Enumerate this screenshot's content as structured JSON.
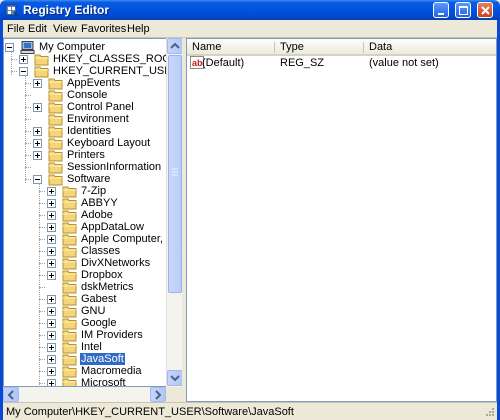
{
  "window": {
    "title": "Registry Editor"
  },
  "menu": [
    "File",
    "Edit",
    "View",
    "Favorites",
    "Help"
  ],
  "tree": {
    "root": "My Computer",
    "hives": [
      "HKEY_CLASSES_ROOT",
      "HKEY_CURRENT_USER"
    ],
    "hkcu_children": [
      "AppEvents",
      "Console",
      "Control Panel",
      "Environment",
      "Identities",
      "Keyboard Layout",
      "Printers",
      "SessionInformation",
      "Software"
    ],
    "software_children": [
      "7-Zip",
      "ABBYY",
      "Adobe",
      "AppDataLow",
      "Apple Computer, Inc.",
      "Classes",
      "DivXNetworks",
      "Dropbox",
      "dskMetrics",
      "Gabest",
      "GNU",
      "Google",
      "IM Providers",
      "Intel",
      "JavaSoft",
      "Macromedia",
      "Microsoft"
    ],
    "selected": "JavaSoft"
  },
  "list": {
    "columns": [
      "Name",
      "Type",
      "Data"
    ],
    "rows": [
      {
        "name": "(Default)",
        "type": "REG_SZ",
        "data": "(value not set)"
      }
    ]
  },
  "status": "My Computer\\HKEY_CURRENT_USER\\Software\\JavaSoft",
  "icons": {
    "app": "registry-editor-icon",
    "computer": "computer-icon",
    "folder": "folder-icon",
    "string_value": "reg-sz-icon"
  },
  "colors": {
    "selection": "#316ac5",
    "titlebar": "#0054e3",
    "folder": "#f6d57a"
  }
}
